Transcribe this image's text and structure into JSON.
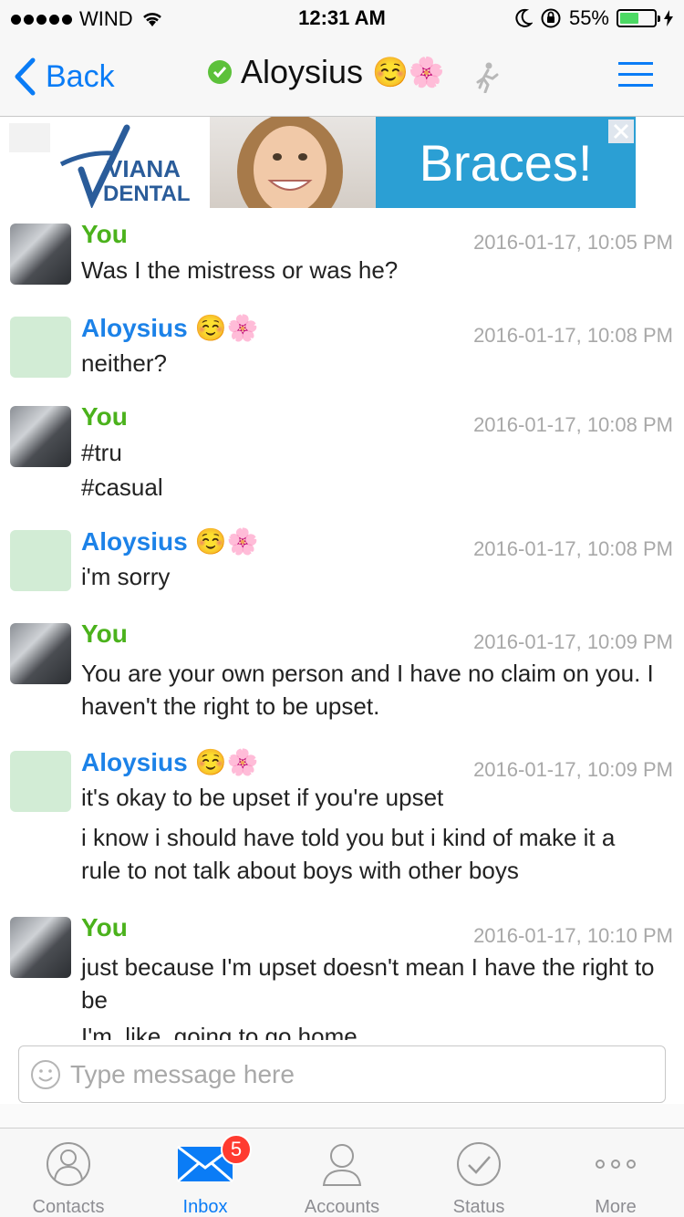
{
  "status_bar": {
    "carrier": "WIND",
    "time": "12:31 AM",
    "battery_percent": "55%",
    "battery_level": 0.55
  },
  "nav": {
    "back_label": "Back",
    "title": "Aloysius",
    "title_emoji": "☺️🌸"
  },
  "ad": {
    "brand_line1": "VIANA",
    "brand_line2": "DENTAL",
    "headline": "Braces!"
  },
  "messages": [
    {
      "sender": "You",
      "emoji": "",
      "timestamp": "2016-01-17, 10:05 PM",
      "lines": [
        "Was I the mistress or was he?"
      ]
    },
    {
      "sender": "Aloysius",
      "emoji": "☺️🌸",
      "timestamp": "2016-01-17, 10:08 PM",
      "lines": [
        "neither?"
      ]
    },
    {
      "sender": "You",
      "emoji": "",
      "timestamp": "2016-01-17, 10:08 PM",
      "lines": [
        "#tru",
        "#casual"
      ]
    },
    {
      "sender": "Aloysius",
      "emoji": "☺️🌸",
      "timestamp": "2016-01-17, 10:08 PM",
      "lines": [
        "i'm sorry"
      ]
    },
    {
      "sender": "You",
      "emoji": "",
      "timestamp": "2016-01-17, 10:09 PM",
      "lines": [
        "You are your own person and I have no claim on you. I haven't the right to be upset."
      ]
    },
    {
      "sender": "Aloysius",
      "emoji": "☺️🌸",
      "timestamp": "2016-01-17, 10:09 PM",
      "lines": [
        "it's okay to be upset if you're upset",
        "i know i should have told you but i kind of make it a rule to not talk about boys with other boys"
      ]
    },
    {
      "sender": "You",
      "emoji": "",
      "timestamp": "2016-01-17, 10:10 PM",
      "lines": [
        "just because I'm upset doesn't mean I have the right to be",
        "I'm, like, going to go home"
      ]
    }
  ],
  "input": {
    "placeholder": "Type message here"
  },
  "tabs": [
    {
      "label": "Contacts",
      "icon": "contacts-icon",
      "active": false
    },
    {
      "label": "Inbox",
      "icon": "envelope-icon",
      "active": true,
      "badge": "5"
    },
    {
      "label": "Accounts",
      "icon": "person-icon",
      "active": false
    },
    {
      "label": "Status",
      "icon": "checkmark-circle-icon",
      "active": false
    },
    {
      "label": "More",
      "icon": "ellipsis-icon",
      "active": false
    }
  ],
  "colors": {
    "accent": "#0a7cf6",
    "you_name": "#4bb21c",
    "other_name": "#1c82e8",
    "online": "#5cc13a",
    "badge": "#ff3b30",
    "ad_banner": "#2b9fd4"
  }
}
